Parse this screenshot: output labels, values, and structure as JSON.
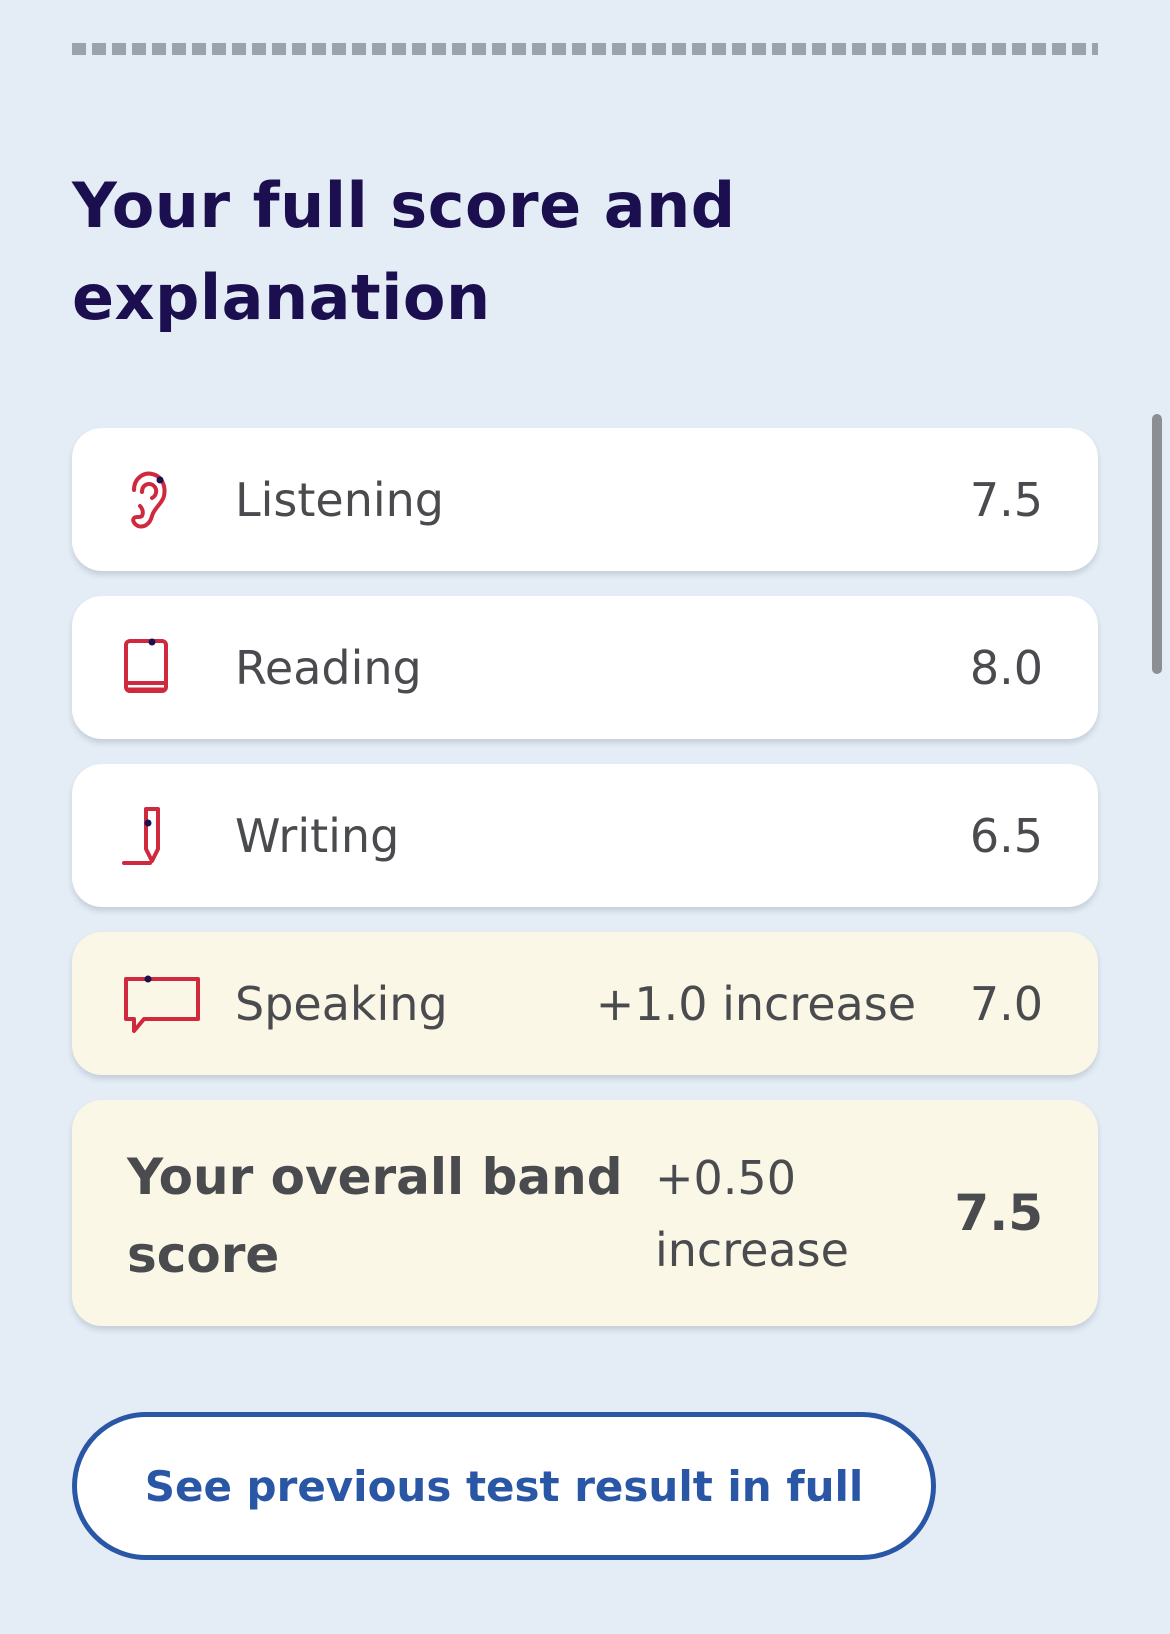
{
  "heading": "Your full score and explanation",
  "scores": [
    {
      "label": "Listening",
      "value": "7.5",
      "icon": "ear-icon"
    },
    {
      "label": "Reading",
      "value": "8.0",
      "icon": "book-icon"
    },
    {
      "label": "Writing",
      "value": "6.5",
      "icon": "pencil-icon"
    },
    {
      "label": "Speaking",
      "change": "+1.0 increase",
      "value": "7.0",
      "icon": "speech-bubble-icon"
    }
  ],
  "overall": {
    "label": "Your overall band score",
    "change": "+0.50 increase",
    "value": "7.5"
  },
  "previous_button_label": "See previous test result in full",
  "colors": {
    "background": "#e4edf6",
    "heading": "#1b0f50",
    "icon_accent": "#d0283c",
    "highlight_card": "#faf7e6",
    "button_accent": "#2a56a6"
  }
}
